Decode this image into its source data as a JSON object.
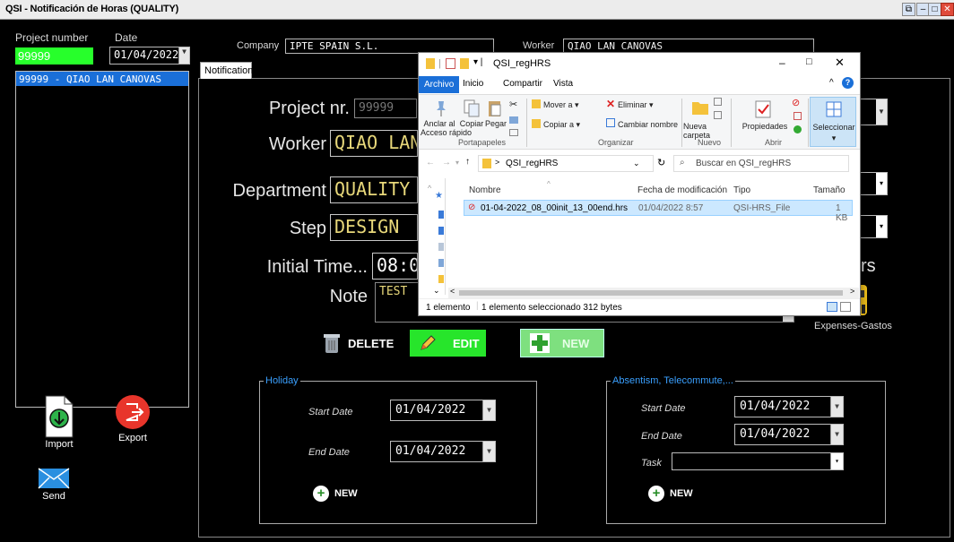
{
  "window": {
    "title": "QSI - Notificación de Horas (QUALITY)"
  },
  "left": {
    "project_number_label": "Project number",
    "project_number_value": "99999",
    "date_label": "Date",
    "date_value": "01/04/2022",
    "project_list": [
      "99999 - QIAO LAN CANOVAS"
    ],
    "import_label": "Import",
    "export_label": "Export",
    "send_label": "Send"
  },
  "header": {
    "company_label": "Company",
    "company_value": "IPTE SPAIN S.L.",
    "worker_label": "Worker",
    "worker_value": "QIAO LAN CANOVAS"
  },
  "tab": {
    "label": "Notification"
  },
  "form": {
    "project_label": "Project nr.",
    "project_value": "99999",
    "worker_label": "Worker",
    "worker_value": "QIAO LAN",
    "department_label": "Department",
    "department_value": "QUALITY",
    "step_label": "Step",
    "step_value": "DESIGN",
    "initial_time_label": "Initial Time...",
    "initial_time_value": "08:0",
    "note_label": "Note",
    "note_value": "TEST",
    "hours_partial": "rs",
    "expenses_label": "Expenses-Gastos"
  },
  "actions": {
    "delete": "DELETE",
    "edit": "EDIT",
    "new": "NEW"
  },
  "holiday": {
    "title": "Holiday",
    "start_label": "Start Date",
    "start_value": "01/04/2022",
    "end_label": "End Date",
    "end_value": "01/04/2022",
    "new_label": "NEW"
  },
  "absentism": {
    "title": "Absentism, Telecommute,...",
    "start_label": "Start Date",
    "start_value": "01/04/2022",
    "end_label": "End Date",
    "end_value": "01/04/2022",
    "task_label": "Task",
    "task_value": "",
    "new_label": "NEW"
  },
  "explorer": {
    "title": "QSI_regHRS",
    "tabs": [
      "Archivo",
      "Inicio",
      "Compartir",
      "Vista"
    ],
    "ribbon": {
      "pin": "Anclar al\nAcceso rápido",
      "copy": "Copiar",
      "paste": "Pegar",
      "move_to": "Mover a ▾",
      "copy_to": "Copiar a ▾",
      "delete": "Eliminar ▾",
      "rename": "Cambiar nombre",
      "new_folder": "Nueva\ncarpeta",
      "properties": "Propiedades",
      "select": "Seleccionar",
      "groups": [
        "Portapapeles",
        "Organizar",
        "Nuevo",
        "Abrir"
      ]
    },
    "path": "QSI_regHRS",
    "search_placeholder": "Buscar en QSI_regHRS",
    "columns": [
      "Nombre",
      "Fecha de modificación",
      "Tipo",
      "Tamaño"
    ],
    "files": [
      {
        "name": "01-04-2022_08_00init_13_00end.hrs",
        "modified": "01/04/2022 8:57",
        "type": "QSI-HRS_File",
        "size": "1 KB"
      }
    ],
    "status_count": "1 elemento",
    "status_selected": "1 elemento seleccionado  312 bytes"
  },
  "colors": {
    "accent_green": "#27ff2b",
    "selection_blue": "#1a6fd8",
    "group_title": "#3aa0ff"
  }
}
